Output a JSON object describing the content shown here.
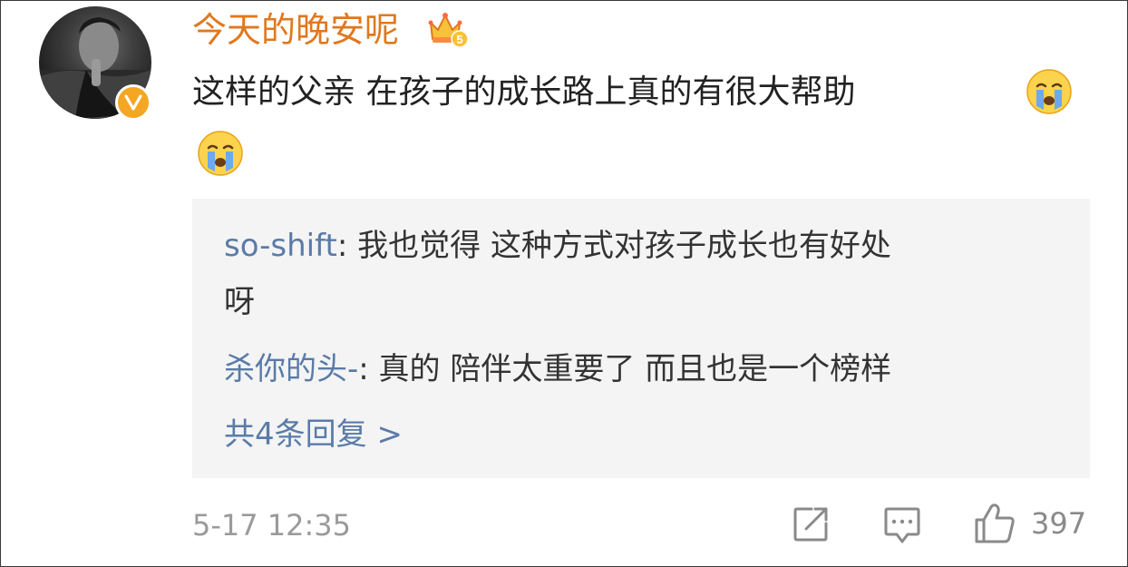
{
  "comment": {
    "username": "今天的晚安呢",
    "text_line1": "这样的父亲 在孩子的成长路上真的有很大帮助",
    "avatar_icon": "avatar-image",
    "badge_icon": "verified-v-icon",
    "level_icon": "crown-level-5-icon",
    "emoji_icon": "crying-face-emoji"
  },
  "replies": [
    {
      "author": "so-shift",
      "separator": ": ",
      "text_line1": "我也觉得 这种方式对孩子成长也有好处",
      "text_line2": "呀"
    },
    {
      "author": "杀你的头-",
      "separator": ": ",
      "text_line1": "真的 陪伴太重要了 而且也是一个榜样"
    }
  ],
  "more_replies_label": "共4条回复 >",
  "footer": {
    "timestamp": "5-17 12:35",
    "like_count": "397",
    "share_icon": "share-icon",
    "comment_icon": "comment-icon",
    "like_icon": "thumbs-up-icon"
  },
  "colors": {
    "username": "#e0781e",
    "reply_author": "#5a7ba8",
    "badge": "#f5a623",
    "reply_bg": "#f4f4f4"
  }
}
